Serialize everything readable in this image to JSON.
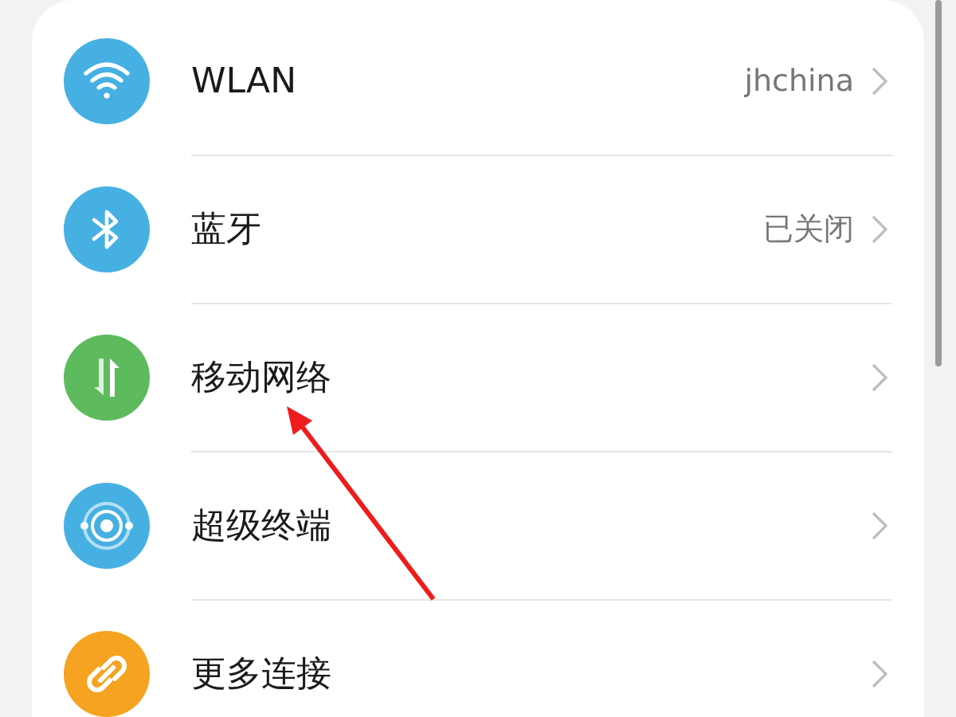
{
  "settings": [
    {
      "kind": "wifi",
      "color": "#47b0e3",
      "label": "WLAN",
      "value": "jhchina"
    },
    {
      "kind": "bluetooth",
      "color": "#47b0e3",
      "label": "蓝牙",
      "value": "已关闭"
    },
    {
      "kind": "mobile",
      "color": "#5dba5d",
      "label": "移动网络"
    },
    {
      "kind": "devices",
      "color": "#47b0e3",
      "label": "超级终端"
    },
    {
      "kind": "link",
      "color": "#f5a321",
      "label": "更多连接"
    }
  ]
}
